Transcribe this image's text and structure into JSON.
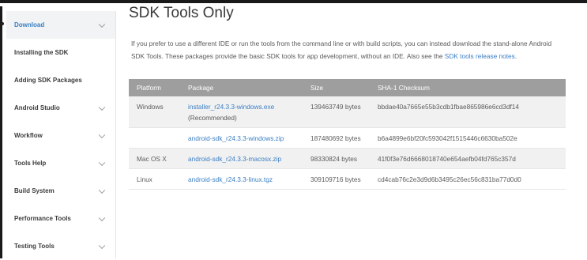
{
  "sidebar": {
    "items": [
      {
        "label": "Download",
        "chevron": true,
        "active": true
      },
      {
        "label": "Installing the SDK",
        "chevron": false
      },
      {
        "label": "Adding SDK Packages",
        "chevron": false
      },
      {
        "label": "Android Studio",
        "chevron": true
      },
      {
        "label": "Workflow",
        "chevron": true
      },
      {
        "label": "Tools Help",
        "chevron": true
      },
      {
        "label": "Build System",
        "chevron": true
      },
      {
        "label": "Performance Tools",
        "chevron": true
      },
      {
        "label": "Testing Tools",
        "chevron": true
      }
    ]
  },
  "main": {
    "title": "SDK Tools Only",
    "intro_text": "If you prefer to use a different IDE or run the tools from the command line or with build scripts, you can instead download the stand-alone Android SDK Tools. These packages provide the basic SDK tools for app development, without an IDE. Also see the",
    "intro_link": "SDK tools release notes",
    "intro_end": "."
  },
  "table": {
    "headers": [
      "Platform",
      "Package",
      "Size",
      "SHA-1 Checksum"
    ],
    "rows": [
      {
        "platform": "Windows",
        "package": "installer_r24.3.3-windows.exe",
        "note": "(Recommended)",
        "size": "139463749 bytes",
        "sha": "bbdae40a7665e55b3cdb1fbae865986e6cd3df14"
      },
      {
        "platform": "",
        "package": "android-sdk_r24.3.3-windows.zip",
        "note": "",
        "size": "187480692 bytes",
        "sha": "b6a4899e6bf20fc593042f1515446c6630ba502e"
      },
      {
        "platform": "Mac OS X",
        "package": "android-sdk_r24.3.3-macosx.zip",
        "note": "",
        "size": "98330824 bytes",
        "sha": "41f0f3e76d6668018740e654aefb04fd765c357d"
      },
      {
        "platform": "Linux",
        "package": "android-sdk_r24.3.3-linux.tgz",
        "note": "",
        "size": "309109716 bytes",
        "sha": "cd4cab76c2e3d9d6b3495c26ec56c831ba77d0d0"
      }
    ]
  },
  "colors": {
    "accent": "#3b7fc4",
    "header_bg": "#9e9e9e",
    "row_alt": "#f1f1f1"
  }
}
